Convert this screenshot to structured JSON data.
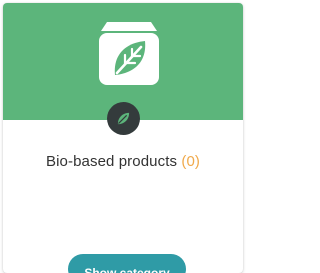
{
  "category": {
    "name": "Bio-based products",
    "count_display": "(0)",
    "icon": "leaf-box-icon",
    "badge_icon": "leaf-icon",
    "button_label": "Show category"
  },
  "colors": {
    "banner": "#5cb57b",
    "badge": "#343b3c",
    "count": "#f0a94a",
    "button": "#2f9ba6"
  }
}
